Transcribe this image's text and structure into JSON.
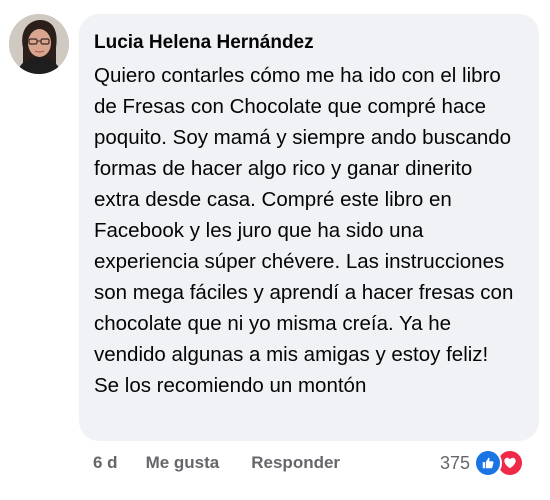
{
  "comment": {
    "author": "Lucia Helena Hernández",
    "text": "Quiero contarles cómo me ha ido con el libro de Fresas con Chocolate que compré hace poquito. Soy mamá y siempre ando buscando formas de hacer algo rico y ganar dinerito extra desde casa. Compré este libro en Facebook y les juro que ha sido una experiencia súper chévere. Las instrucciones son mega fáciles y aprendí a hacer fresas con chocolate que ni yo misma creía. Ya he vendido algunas a mis amigas y estoy feliz! Se los recomiendo un montón"
  },
  "actions": {
    "time": "6 d",
    "like_label": "Me gusta",
    "reply_label": "Responder"
  },
  "reactions": {
    "count": "375",
    "icons": [
      "like-icon",
      "love-icon"
    ],
    "like_color": "#1b74e4",
    "love_color": "#f02849"
  },
  "colors": {
    "bubble": "#f0f2f5",
    "text": "#050505",
    "secondary": "#65676b"
  }
}
